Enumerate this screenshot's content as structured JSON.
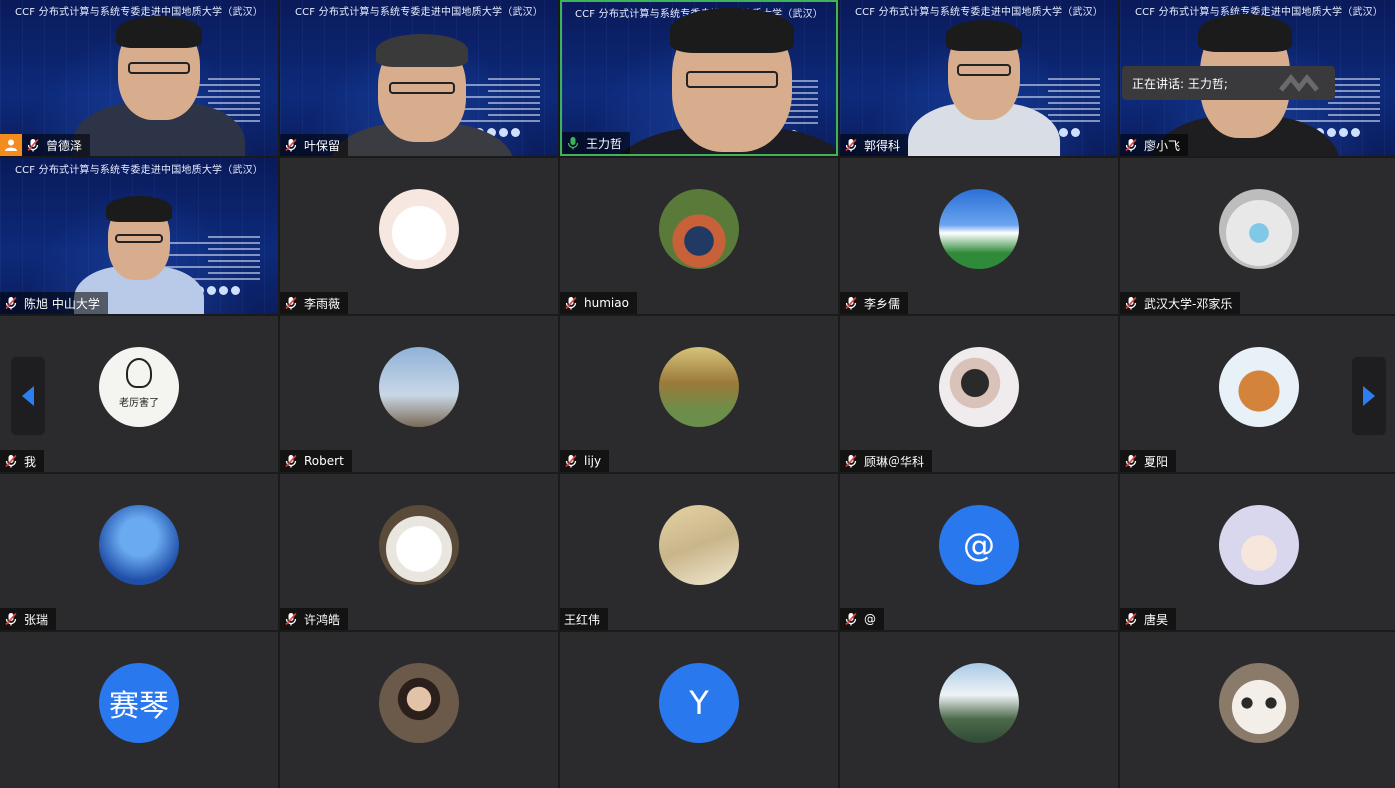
{
  "slide_title": "CCF 分布式计算与系统专委走进中国地质大学（武汉）",
  "active_speaker_popup": "正在讲话: 王力哲;",
  "colors": {
    "active_border": "#3fb35a",
    "muted_mic": "#e0423a",
    "avatar_blue": "#2a78ee",
    "host_badge": "#f48b1f"
  },
  "participants": [
    {
      "name": "曾德泽",
      "type": "video",
      "mic": "muted",
      "host": true
    },
    {
      "name": "叶保留",
      "type": "video",
      "mic": "muted"
    },
    {
      "name": "王力哲",
      "type": "video",
      "mic": "active",
      "speaking": true
    },
    {
      "name": "郭得科",
      "type": "video",
      "mic": "muted"
    },
    {
      "name": "廖小飞",
      "type": "video",
      "mic": "muted"
    },
    {
      "name": "陈旭 中山大学",
      "type": "video",
      "mic": "muted"
    },
    {
      "name": "李雨薇",
      "type": "avatar",
      "avatar": "cartoon-girl",
      "mic": "muted"
    },
    {
      "name": "humiao",
      "type": "avatar",
      "avatar": "photo-person-flowers",
      "mic": "muted"
    },
    {
      "name": "李乡儒",
      "type": "avatar",
      "avatar": "blue-sky",
      "mic": "muted"
    },
    {
      "name": "武汉大学-邓家乐",
      "type": "avatar",
      "avatar": "sketch-mask",
      "mic": "muted"
    },
    {
      "name": "我",
      "type": "avatar",
      "avatar": "bunny-sticker",
      "avatar_text": "老厉害了",
      "mic": "muted"
    },
    {
      "name": "Robert",
      "type": "avatar",
      "avatar": "eiffel-tower",
      "mic": "muted"
    },
    {
      "name": "lijy",
      "type": "avatar",
      "avatar": "painting-landscape",
      "mic": "muted"
    },
    {
      "name": "顾琳＠华科",
      "type": "avatar",
      "avatar": "photo-woman",
      "mic": "muted"
    },
    {
      "name": "夏阳",
      "type": "avatar",
      "avatar": "lion-cat-crown",
      "mic": "muted"
    },
    {
      "name": "张瑞",
      "type": "avatar",
      "avatar": "blue-dome",
      "mic": "muted"
    },
    {
      "name": "许鸿皓",
      "type": "avatar",
      "avatar": "cartoon-glasses-girl",
      "mic": "muted"
    },
    {
      "name": "王红伟",
      "type": "avatar",
      "avatar": "anime-man",
      "mic": "none"
    },
    {
      "name": "@",
      "type": "avatar",
      "avatar_letter": "@",
      "mic": "muted"
    },
    {
      "name": "唐昊",
      "type": "avatar",
      "avatar": "cartoon-goose",
      "mic": "muted"
    },
    {
      "name": "",
      "type": "avatar",
      "avatar_letter": "赛琴"
    },
    {
      "name": "",
      "type": "avatar",
      "avatar": "photo-woman-restaurant"
    },
    {
      "name": "",
      "type": "avatar",
      "avatar_letter": "Y"
    },
    {
      "name": "",
      "type": "avatar",
      "avatar": "waterfall"
    },
    {
      "name": "",
      "type": "avatar",
      "avatar": "cat-face"
    }
  ],
  "nav": {
    "prev_icon": "arrow-left-icon",
    "next_icon": "arrow-right-icon"
  }
}
